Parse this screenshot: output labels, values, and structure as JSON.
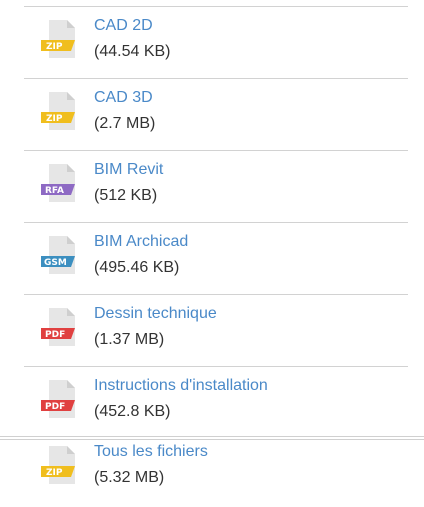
{
  "files": [
    {
      "name": "CAD 2D",
      "size": "(44.54 KB)",
      "badge": "ZIP",
      "badge_color": "#f0be1e",
      "icon": "zip-file-icon"
    },
    {
      "name": "CAD 3D",
      "size": "(2.7 MB)",
      "badge": "ZIP",
      "badge_color": "#f0be1e",
      "icon": "zip-file-icon"
    },
    {
      "name": "BIM Revit",
      "size": "(512 KB)",
      "badge": "RFA",
      "badge_color": "#8e6ac4",
      "icon": "rfa-file-icon"
    },
    {
      "name": "BIM Archicad",
      "size": "(495.46 KB)",
      "badge": "GSM",
      "badge_color": "#3c8fc0",
      "icon": "gsm-file-icon"
    },
    {
      "name": "Dessin technique",
      "size": "(1.37 MB)",
      "badge": "PDF",
      "badge_color": "#e04040",
      "icon": "pdf-file-icon"
    },
    {
      "name": "Instructions d'installation",
      "size": "(452.8 KB)",
      "badge": "PDF",
      "badge_color": "#e04040",
      "icon": "pdf-file-icon"
    }
  ],
  "all_files": {
    "name": "Tous les fichiers",
    "size": "(5.32 MB)",
    "badge": "ZIP",
    "badge_color": "#f0be1e",
    "icon": "zip-file-icon"
  },
  "colors": {
    "link": "#4a89c8",
    "text": "#333333",
    "page_fold": "#e6e6e6",
    "separator": "#d2d2d2"
  }
}
